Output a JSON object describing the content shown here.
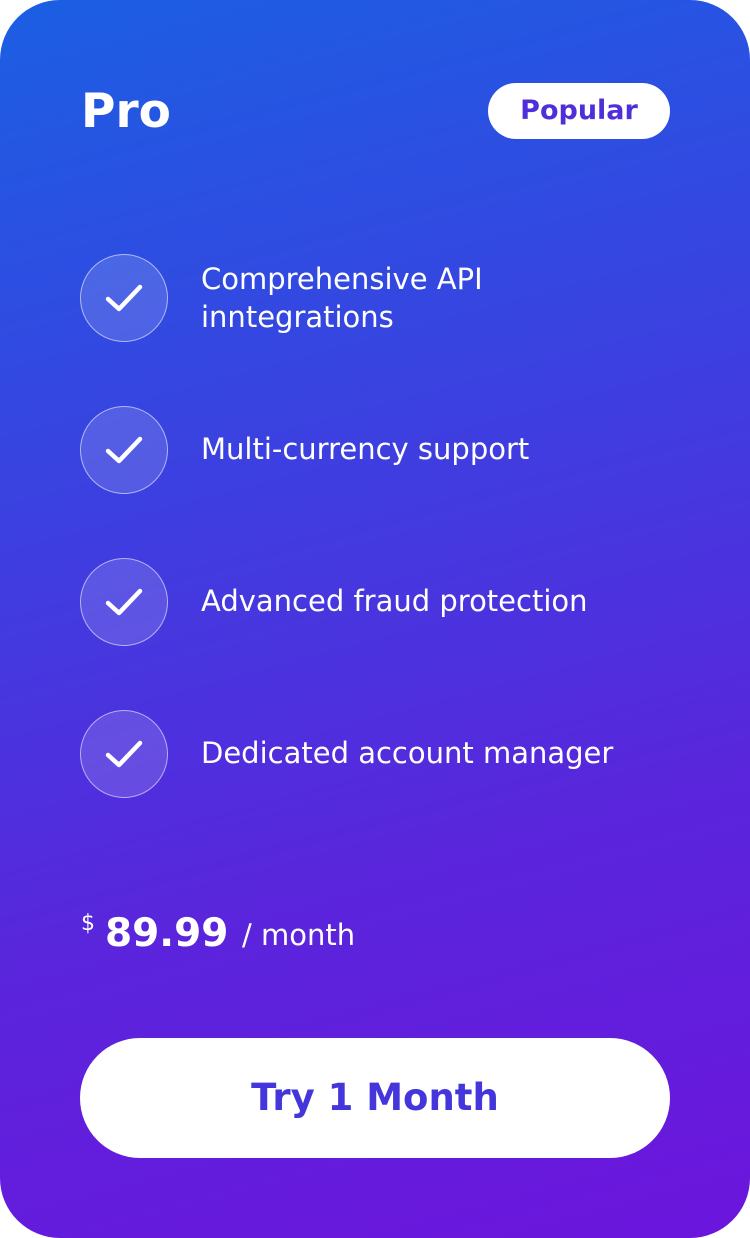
{
  "plan": {
    "name": "Pro",
    "badge": "Popular"
  },
  "features": [
    {
      "label": "Comprehensive API inntegrations",
      "icon": "check-icon"
    },
    {
      "label": "Multi-currency support",
      "icon": "check-icon"
    },
    {
      "label": "Advanced fraud protection",
      "icon": "check-icon"
    },
    {
      "label": "Dedicated account manager",
      "icon": "check-icon"
    }
  ],
  "price": {
    "currency": "$",
    "amount": "89.99",
    "period": "/ month"
  },
  "cta": {
    "label": "Try 1 Month"
  },
  "colors": {
    "gradient_start": "#1b5fe3",
    "gradient_end": "#6c15dc",
    "badge_text": "#4f2fd9",
    "cta_text": "#4536db"
  }
}
